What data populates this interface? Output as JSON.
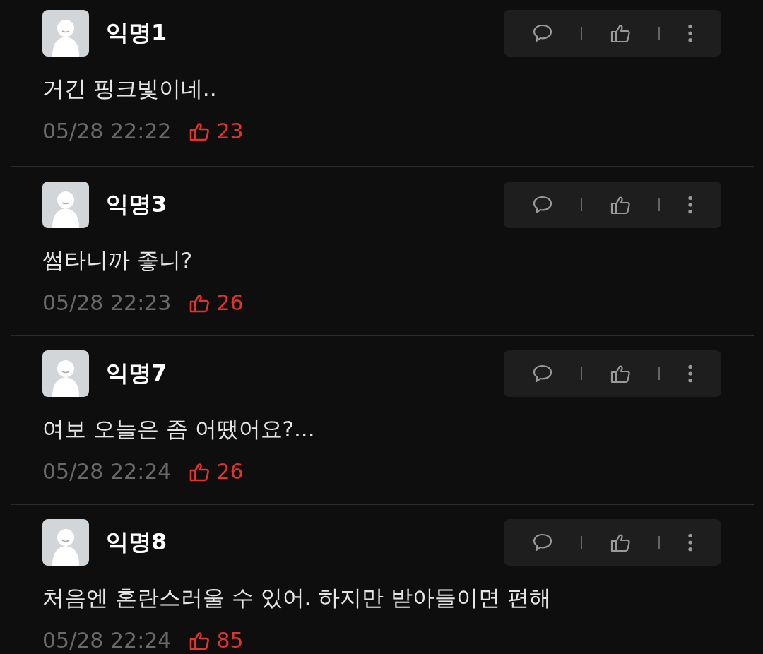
{
  "comments": [
    {
      "author": "익명1",
      "text": "거긴 핑크빛이네..",
      "time": "05/28 22:22",
      "likes": "23"
    },
    {
      "author": "익명3",
      "text": "썸타니까 좋니?",
      "time": "05/28 22:23",
      "likes": "26"
    },
    {
      "author": "익명7",
      "text": "여보 오늘은 좀 어땠어요?...",
      "time": "05/28 22:24",
      "likes": "26"
    },
    {
      "author": "익명8",
      "text": "처음엔 혼란스러울 수 있어. 하지만 받아들이면 편해",
      "time": "05/28 22:24",
      "likes": "85"
    }
  ]
}
